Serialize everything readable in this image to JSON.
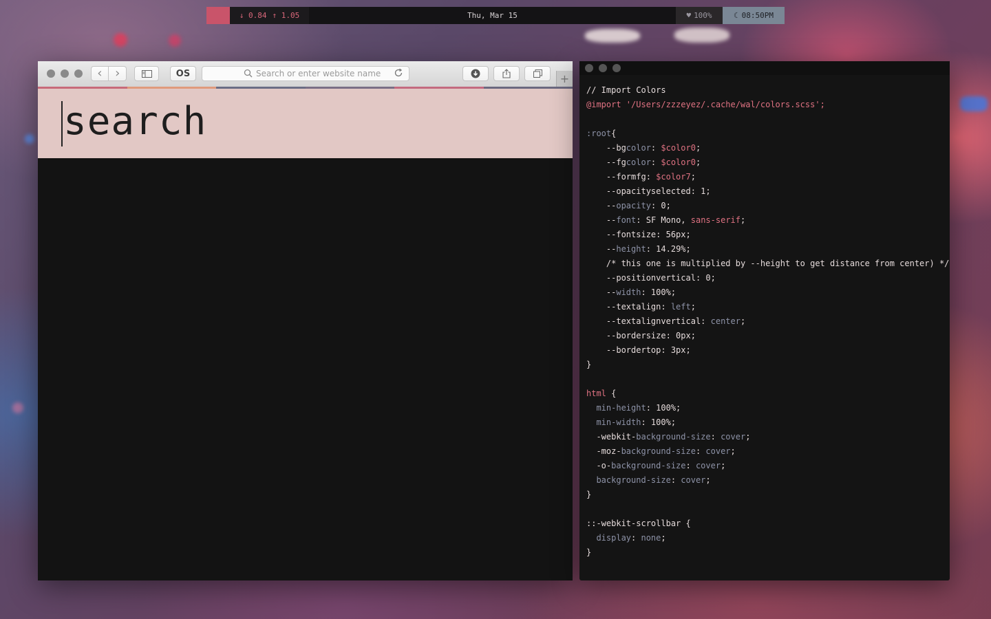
{
  "topbar": {
    "apple_glyph": "",
    "net_down": "↓ 0.84",
    "net_up": "↑ 1.05",
    "date": "Thu, Mar 15",
    "battery_icon": "♥",
    "battery": "100%",
    "moon_icon": "☾",
    "time": "08:50PM",
    "colors": {
      "accent": "#c9546a",
      "time_bg": "#7a8795"
    }
  },
  "browser": {
    "toolbar": {
      "back_icon": "‹",
      "forward_icon": "›",
      "sidebar_icon": "sidebar-icon",
      "extension_label": "OS",
      "url_placeholder": "Search or enter website name",
      "search_icon": "search-icon",
      "reload_icon": "reload-icon",
      "download_icon": "download-icon",
      "share_icon": "share-icon",
      "tabs_icon": "tabs-icon",
      "new_tab_label": "+"
    },
    "accent_colors": [
      "#c86a7a",
      "#e09a7c",
      "#6a6d85",
      "#7a6f86",
      "#c46a80",
      "#6b6980"
    ],
    "search_value": "search",
    "colors": {
      "panel_bg": "#e2c8c5",
      "body_bg": "#131313"
    }
  },
  "terminal": {
    "lines": [
      [
        {
          "t": "// Import Colors",
          "c": "cmt"
        }
      ],
      [
        {
          "t": "@import",
          "c": "kw"
        },
        {
          "t": " '/Users/zzzeyez/.cache/wal/colors.scss';",
          "c": "str"
        }
      ],
      [],
      [
        {
          "t": ":root",
          "c": "prop"
        },
        {
          "t": "{",
          "c": "pl"
        }
      ],
      [
        {
          "t": "    --bg",
          "c": "pl"
        },
        {
          "t": "color",
          "c": "prop"
        },
        {
          "t": ": ",
          "c": "pl"
        },
        {
          "t": "$color0",
          "c": "var"
        },
        {
          "t": ";",
          "c": "pl"
        }
      ],
      [
        {
          "t": "    --fg",
          "c": "pl"
        },
        {
          "t": "color",
          "c": "prop"
        },
        {
          "t": ": ",
          "c": "pl"
        },
        {
          "t": "$color0",
          "c": "var"
        },
        {
          "t": ";",
          "c": "pl"
        }
      ],
      [
        {
          "t": "    --formfg: ",
          "c": "pl"
        },
        {
          "t": "$color7",
          "c": "var"
        },
        {
          "t": ";",
          "c": "pl"
        }
      ],
      [
        {
          "t": "    --opacityselected: 1;",
          "c": "pl"
        }
      ],
      [
        {
          "t": "    --",
          "c": "pl"
        },
        {
          "t": "opacity",
          "c": "prop"
        },
        {
          "t": ": 0;",
          "c": "pl"
        }
      ],
      [
        {
          "t": "    --",
          "c": "pl"
        },
        {
          "t": "font",
          "c": "prop"
        },
        {
          "t": ": SF Mono, ",
          "c": "pl"
        },
        {
          "t": "sans-serif",
          "c": "var"
        },
        {
          "t": ";",
          "c": "pl"
        }
      ],
      [
        {
          "t": "    --fontsize: 56px;",
          "c": "pl"
        }
      ],
      [
        {
          "t": "    --",
          "c": "pl"
        },
        {
          "t": "height",
          "c": "prop"
        },
        {
          "t": ": 14.29%;",
          "c": "pl"
        }
      ],
      [
        {
          "t": "    /* this one is multiplied by --height to get distance from center) */",
          "c": "cmt"
        }
      ],
      [
        {
          "t": "    --positionvertical: 0;",
          "c": "pl"
        }
      ],
      [
        {
          "t": "    --",
          "c": "pl"
        },
        {
          "t": "width",
          "c": "prop"
        },
        {
          "t": ": 100%;",
          "c": "pl"
        }
      ],
      [
        {
          "t": "    --textalign: ",
          "c": "pl"
        },
        {
          "t": "left",
          "c": "val"
        },
        {
          "t": ";",
          "c": "pl"
        }
      ],
      [
        {
          "t": "    --textalignvertical: ",
          "c": "pl"
        },
        {
          "t": "center",
          "c": "val"
        },
        {
          "t": ";",
          "c": "pl"
        }
      ],
      [
        {
          "t": "    --bordersize: 0px;",
          "c": "pl"
        }
      ],
      [
        {
          "t": "    --bordertop: 3px;",
          "c": "pl"
        }
      ],
      [
        {
          "t": "}",
          "c": "pl"
        }
      ],
      [],
      [
        {
          "t": "html",
          "c": "kw"
        },
        {
          "t": " {",
          "c": "pl"
        }
      ],
      [
        {
          "t": "  ",
          "c": "pl"
        },
        {
          "t": "min-height",
          "c": "prop"
        },
        {
          "t": ": 100%;",
          "c": "pl"
        }
      ],
      [
        {
          "t": "  ",
          "c": "pl"
        },
        {
          "t": "min-width",
          "c": "prop"
        },
        {
          "t": ": 100%;",
          "c": "pl"
        }
      ],
      [
        {
          "t": "  -webkit-",
          "c": "pl"
        },
        {
          "t": "background-size",
          "c": "prop"
        },
        {
          "t": ": ",
          "c": "pl"
        },
        {
          "t": "cover",
          "c": "val"
        },
        {
          "t": ";",
          "c": "pl"
        }
      ],
      [
        {
          "t": "  -moz-",
          "c": "pl"
        },
        {
          "t": "background-size",
          "c": "prop"
        },
        {
          "t": ": ",
          "c": "pl"
        },
        {
          "t": "cover",
          "c": "val"
        },
        {
          "t": ";",
          "c": "pl"
        }
      ],
      [
        {
          "t": "  -o-",
          "c": "pl"
        },
        {
          "t": "background-size",
          "c": "prop"
        },
        {
          "t": ": ",
          "c": "pl"
        },
        {
          "t": "cover",
          "c": "val"
        },
        {
          "t": ";",
          "c": "pl"
        }
      ],
      [
        {
          "t": "  ",
          "c": "pl"
        },
        {
          "t": "background-size",
          "c": "prop"
        },
        {
          "t": ": ",
          "c": "pl"
        },
        {
          "t": "cover",
          "c": "val"
        },
        {
          "t": ";",
          "c": "pl"
        }
      ],
      [
        {
          "t": "}",
          "c": "pl"
        }
      ],
      [],
      [
        {
          "t": "::-webkit-scrollbar {",
          "c": "pl"
        }
      ],
      [
        {
          "t": "  ",
          "c": "pl"
        },
        {
          "t": "display",
          "c": "prop"
        },
        {
          "t": ": ",
          "c": "pl"
        },
        {
          "t": "none",
          "c": "val"
        },
        {
          "t": ";",
          "c": "pl"
        }
      ],
      [
        {
          "t": "}",
          "c": "pl"
        }
      ]
    ]
  }
}
